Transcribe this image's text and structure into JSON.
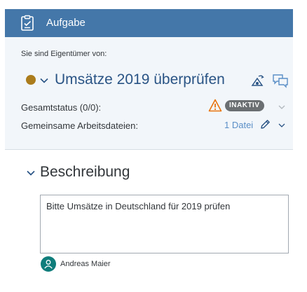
{
  "header": {
    "title": "Aufgabe",
    "icon": "clipboard-task-icon"
  },
  "object": {
    "owner_label": "Sie sind Eigentümer von:",
    "title": "Umsätze 2019 überprüfen",
    "priority_color": "#ab7c1c",
    "actions": [
      "share-icon",
      "comment-icon"
    ]
  },
  "fields": {
    "status_label": "Gesamtstatus (0/0):",
    "status_badge": "INAKTIV",
    "files_label": "Gemeinsame Arbeitsdateien:",
    "files_link": "1 Datei"
  },
  "description": {
    "section_title": "Beschreibung",
    "text": "Bitte Umsätze in Deutschland für 2019 prüfen",
    "author": "Andreas Maier"
  },
  "colors": {
    "header_bg": "#4477a9",
    "title_blue": "#2a5485",
    "link_blue": "#5b8fc7",
    "warning": "#e9730c",
    "badge_bg": "#6b6f72",
    "avatar_bg": "#0f7d7b"
  }
}
